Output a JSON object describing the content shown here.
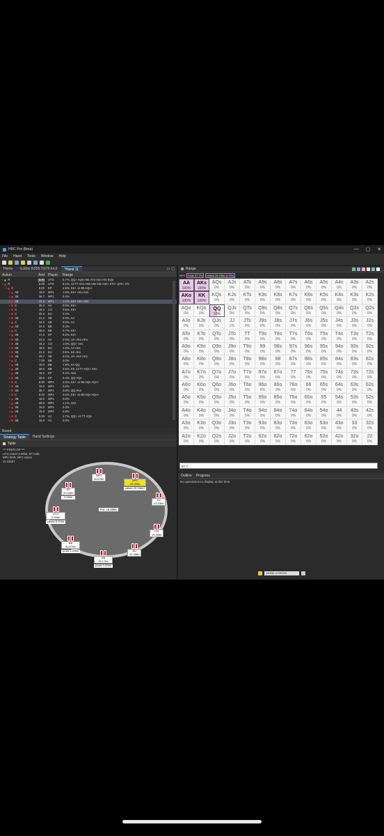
{
  "window": {
    "title": "HRC Pro (Beta)",
    "controls": [
      "—",
      "▢",
      "✕"
    ]
  },
  "menu": [
    "File",
    "Hand",
    "Tools",
    "Window",
    "Help"
  ],
  "doc_tabs": [
    "Home",
    "\\Lobby 6\\255.7(67h.hrc3",
    "*Hand 11"
  ],
  "tree": {
    "headers": [
      "Action",
      "Amt [BB]",
      "Player",
      "Range"
    ],
    "rows": [
      {
        "action": "R",
        "amt": "2.00",
        "player": "UTG",
        "range": "5.7%, QQ+ AQs-A5s A7o-A4o ATo KQo",
        "color": "#3cb44b"
      },
      {
        "action": "R",
        "amt": "8.00",
        "player": "UTG",
        "range": "8.1%, JJ-TT AKs-A9s A8s A5s A3s+ KTs+ QTs+ JTs",
        "color": "#e6194b"
      },
      {
        "action": "C",
        "amt": "8.00",
        "player": "EP",
        "range": "4.5%, KK+ JJ-99 AQo+",
        "color": "#e6194b"
      },
      {
        "action": "3B",
        "amt": "18.0",
        "player": "MP1",
        "range": "1.9%, KK+ AKo AKs",
        "color": "#e6194b"
      },
      {
        "action": "3B",
        "amt": "36.7",
        "player": "MP1",
        "range": "0.2%",
        "color": "#e6194b"
      },
      {
        "action": "3B",
        "amt": "25.3",
        "player": "MP1",
        "range": "1.1%, KK+ AKo AKs",
        "color": "#e6194b"
      },
      {
        "action": "C",
        "amt": "25.3",
        "player": "HJ",
        "range": "0.5%, KK+",
        "color": "#e6194b"
      },
      {
        "action": "C",
        "amt": "19.3",
        "player": "CO",
        "range": "0.5%, KK+",
        "color": "#e6194b"
      },
      {
        "action": "C",
        "amt": "25.3",
        "player": "BU",
        "range": "0.2%",
        "color": "#e6194b"
      },
      {
        "action": "3B",
        "amt": "31.3",
        "player": "SB",
        "range": "0.6%, AA",
        "color": "#e6194b"
      },
      {
        "action": "C",
        "amt": "34.0",
        "player": "SB",
        "range": "0.5%, AA",
        "color": "#e6194b"
      },
      {
        "action": "4B",
        "amt": "24.3",
        "player": "BB",
        "range": "0.2%",
        "color": "#e6194b"
      },
      {
        "action": "C",
        "amt": "28.0",
        "player": "BB",
        "range": "0.7%, KK+",
        "color": "#e6194b"
      },
      {
        "action": "3B",
        "amt": "17.3",
        "player": "EP",
        "range": "0.0%, KK+",
        "color": "#e6194b"
      },
      {
        "action": "3B",
        "amt": "23.3",
        "player": "HJ",
        "range": "2.0%, JJ+ AKs AKo",
        "color": "#e6194b"
      },
      {
        "action": "3B",
        "amt": "19.3",
        "player": "CO",
        "range": "1.0%, QQ+ AKs",
        "color": "#e6194b"
      },
      {
        "action": "3B",
        "amt": "18.0",
        "player": "BU",
        "range": "1.2%, AA AKs",
        "color": "#e6194b"
      },
      {
        "action": "3B",
        "amt": "31.3",
        "player": "BU",
        "range": "0.5%, KK AKs",
        "color": "#e6194b"
      },
      {
        "action": "3B",
        "amt": "29.7",
        "player": "SB",
        "range": "3.0%, JJ+ AKs AKo",
        "color": "#e6194b"
      },
      {
        "action": "C",
        "amt": "7.00",
        "player": "BB",
        "range": "0.0%",
        "color": "#e6194b"
      },
      {
        "action": "3B",
        "amt": "18.0",
        "player": "BB",
        "range": "1.9%, AA QQ",
        "color": "#e6194b"
      },
      {
        "action": "3B",
        "amt": "28.0",
        "player": "BB",
        "range": "2.6%, KK JJ-TT AQs+ AKo",
        "color": "#e6194b"
      },
      {
        "action": "3B",
        "amt": "15.0",
        "player": "EP",
        "range": "0.4%, AKs",
        "color": "#e6194b"
      },
      {
        "action": "3B",
        "amt": "28.0",
        "player": "EP",
        "range": "0.4%, QQ AQs",
        "color": "#e6194b"
      },
      {
        "action": "C",
        "amt": "8.00",
        "player": "MP1",
        "range": "4.5%, KK+ JJ-99 AQs AQo+",
        "color": "#e6194b"
      },
      {
        "action": "3B",
        "amt": "15.0",
        "player": "MP1",
        "range": "0.6%",
        "color": "#e6194b"
      },
      {
        "action": "3B",
        "amt": "36.7",
        "player": "MP1",
        "range": "0.8%, QQ AKs",
        "color": "#e6194b"
      },
      {
        "action": "C",
        "amt": "8.00",
        "player": "MP2",
        "range": "3.6%, KK+ JJ-99 AQs AQo+",
        "color": "#e6194b"
      },
      {
        "action": "3B",
        "amt": "15.0",
        "player": "MP1",
        "range": "0.0%",
        "color": "#e6194b"
      },
      {
        "action": "3B",
        "amt": "28.0",
        "player": "MP2",
        "range": "1.1%, AKs",
        "color": "#e6194b"
      },
      {
        "action": "3B",
        "amt": "15.0",
        "player": "MP2",
        "range": "0.3%",
        "color": "#e6194b"
      },
      {
        "action": "3B",
        "amt": "15.0",
        "player": "MP2",
        "range": "0.8%",
        "color": "#e6194b"
      },
      {
        "action": "C",
        "amt": "8.00",
        "player": "HJ",
        "range": "2.7%, QQ+ JJ-TT AQs",
        "color": "#e6194b"
      },
      {
        "action": "3B",
        "amt": "15.0",
        "player": "HJ",
        "range": "0.0%",
        "color": "#e6194b"
      }
    ]
  },
  "board_label": "Board:",
  "lower_tabs": [
    "Strategy Table",
    "Hand Settings"
  ],
  "table_tab": "Table",
  "hand_log": [
    "*** PREFLOP ***",
    "UTG raises 8.00bb, EP calls,",
    "MP1 folds, MP2 raises",
    "25.33bb7"
  ],
  "pot": "Pot:   18.50bb",
  "seats": [
    {
      "name": "MP1",
      "stack": "26.67bb",
      "note": "",
      "active": false
    },
    {
      "name": "MP2",
      "stack": "25.00bb",
      "note": "raises 25.33bb?",
      "active": true
    },
    {
      "name": "HJ",
      "stack": "23.33bb",
      "note": "",
      "active": false
    },
    {
      "name": "CO",
      "stack": "19.33bb",
      "note": "",
      "active": false
    },
    {
      "name": "BU",
      "stack": "31.33bb",
      "note": "",
      "active": false
    },
    {
      "name": "SB",
      "stack": "28.17bb",
      "note": "posts 0.50bb",
      "active": false
    },
    {
      "name": "BB",
      "stack": "84.67bb",
      "note": "posts 1.00bb",
      "active": false
    },
    {
      "name": "UTG",
      "stack": "0.00bb",
      "note": "raises 8.00bb",
      "active": false
    },
    {
      "name": "EP",
      "stack": "20.00bb",
      "note": "0.00bb",
      "active": false
    }
  ],
  "range_panel": {
    "title": "Range",
    "info": [
      "MP2",
      "folds 97.7%",
      "raises 25.33bb (2.3%)"
    ],
    "icon_colors": [
      "#7fbf7f",
      "#a0a0ff",
      "#ffb0b0",
      "#f0f0f0",
      "#7fbfbf",
      "#ffffff"
    ]
  },
  "range_grid": [
    [
      {
        "h": "AA",
        "p": "100%",
        "s": "pink"
      },
      {
        "h": "AKs",
        "p": "100%",
        "s": "pink"
      },
      {
        "h": "AQs",
        "p": "0%"
      },
      {
        "h": "AJs",
        "p": "0%"
      },
      {
        "h": "ATs",
        "p": "0%"
      },
      {
        "h": "A9s",
        "p": "0%"
      },
      {
        "h": "A8s",
        "p": "0%"
      },
      {
        "h": "A7s",
        "p": "0%"
      },
      {
        "h": "A6s",
        "p": "0%"
      },
      {
        "h": "A5s",
        "p": "0%"
      },
      {
        "h": "A4s",
        "p": "0%"
      },
      {
        "h": "A3s",
        "p": "0%"
      },
      {
        "h": "A2s",
        "p": "0%"
      }
    ],
    [
      {
        "h": "AKo",
        "p": "100%",
        "s": "pink"
      },
      {
        "h": "KK",
        "p": "100%",
        "s": "pink"
      },
      {
        "h": "KQs",
        "p": "0%"
      },
      {
        "h": "KJs",
        "p": "0%"
      },
      {
        "h": "KTs",
        "p": "0%"
      },
      {
        "h": "K9s",
        "p": "0%"
      },
      {
        "h": "K8s",
        "p": "0%"
      },
      {
        "h": "K7s",
        "p": "0%"
      },
      {
        "h": "K6s",
        "p": "0%"
      },
      {
        "h": "K5s",
        "p": "0%"
      },
      {
        "h": "K4s",
        "p": "0%"
      },
      {
        "h": "K3s",
        "p": "0%"
      },
      {
        "h": "K2s",
        "p": "0%"
      }
    ],
    [
      {
        "h": "AQo",
        "p": "0%"
      },
      {
        "h": "KQo",
        "p": "0%"
      },
      {
        "h": "QQ",
        "p": "50%",
        "s": "half"
      },
      {
        "h": "QJs",
        "p": "0%"
      },
      {
        "h": "QTs",
        "p": "0%"
      },
      {
        "h": "Q9s",
        "p": "0%"
      },
      {
        "h": "Q8s",
        "p": "0%"
      },
      {
        "h": "Q7s",
        "p": "0%"
      },
      {
        "h": "Q6s",
        "p": "0%"
      },
      {
        "h": "Q5s",
        "p": "0%"
      },
      {
        "h": "Q4s",
        "p": "0%"
      },
      {
        "h": "Q3s",
        "p": "0%"
      },
      {
        "h": "Q2s",
        "p": "0%"
      }
    ],
    [
      {
        "h": "AJo",
        "p": "0%"
      },
      {
        "h": "KJo",
        "p": "0%"
      },
      {
        "h": "QJo",
        "p": "0%"
      },
      {
        "h": "JJ",
        "p": "1%"
      },
      {
        "h": "JTs",
        "p": "0%"
      },
      {
        "h": "J9s",
        "p": "0%"
      },
      {
        "h": "J8s",
        "p": "0%"
      },
      {
        "h": "J7s",
        "p": "0%"
      },
      {
        "h": "J6s",
        "p": "0%"
      },
      {
        "h": "J5s",
        "p": "0%"
      },
      {
        "h": "J4s",
        "p": "0%"
      },
      {
        "h": "J3s",
        "p": "0%"
      },
      {
        "h": "J2s",
        "p": "0%"
      }
    ],
    [
      {
        "h": "ATo",
        "p": "0%"
      },
      {
        "h": "KTo",
        "p": "0%"
      },
      {
        "h": "QTo",
        "p": "0%"
      },
      {
        "h": "JTo",
        "p": "0%"
      },
      {
        "h": "TT",
        "p": "0%"
      },
      {
        "h": "T9s",
        "p": "0%"
      },
      {
        "h": "T8s",
        "p": "0%"
      },
      {
        "h": "T7s",
        "p": "0%"
      },
      {
        "h": "T6s",
        "p": "0%"
      },
      {
        "h": "T5s",
        "p": "0%"
      },
      {
        "h": "T4s",
        "p": "0%"
      },
      {
        "h": "T3s",
        "p": "0%"
      },
      {
        "h": "T2s",
        "p": "0%"
      }
    ],
    [
      {
        "h": "A9o",
        "p": "0%"
      },
      {
        "h": "K9o",
        "p": "0%"
      },
      {
        "h": "Q9o",
        "p": "0%"
      },
      {
        "h": "J9o",
        "p": "0%"
      },
      {
        "h": "T9o",
        "p": "0%"
      },
      {
        "h": "99",
        "p": "0%"
      },
      {
        "h": "98s",
        "p": "0%"
      },
      {
        "h": "97s",
        "p": "0%"
      },
      {
        "h": "96s",
        "p": "0%"
      },
      {
        "h": "95s",
        "p": "0%"
      },
      {
        "h": "94s",
        "p": "0%"
      },
      {
        "h": "93s",
        "p": "0%"
      },
      {
        "h": "92s",
        "p": "0%"
      }
    ],
    [
      {
        "h": "A8o",
        "p": "0%"
      },
      {
        "h": "K8o",
        "p": "0%"
      },
      {
        "h": "Q8o",
        "p": "0%"
      },
      {
        "h": "J8o",
        "p": "0%"
      },
      {
        "h": "T8o",
        "p": "0%"
      },
      {
        "h": "98o",
        "p": "0%"
      },
      {
        "h": "88",
        "p": "0%"
      },
      {
        "h": "87s",
        "p": "0%"
      },
      {
        "h": "86s",
        "p": "0%"
      },
      {
        "h": "85s",
        "p": "0%"
      },
      {
        "h": "84s",
        "p": "0%"
      },
      {
        "h": "83s",
        "p": "0%"
      },
      {
        "h": "82s",
        "p": "0%"
      }
    ],
    [
      {
        "h": "A7o",
        "p": "0%"
      },
      {
        "h": "K7o",
        "p": "0%"
      },
      {
        "h": "Q7o",
        "p": "0%"
      },
      {
        "h": "J7o",
        "p": "0%"
      },
      {
        "h": "T7o",
        "p": "0%"
      },
      {
        "h": "97o",
        "p": "0%"
      },
      {
        "h": "87o",
        "p": "0%"
      },
      {
        "h": "77",
        "p": "0%"
      },
      {
        "h": "76s",
        "p": "0%"
      },
      {
        "h": "75s",
        "p": "0%"
      },
      {
        "h": "74s",
        "p": "0%"
      },
      {
        "h": "73s",
        "p": "0%"
      },
      {
        "h": "72s",
        "p": "0%"
      }
    ],
    [
      {
        "h": "A6o",
        "p": "0%"
      },
      {
        "h": "K6o",
        "p": "0%"
      },
      {
        "h": "Q6o",
        "p": "0%"
      },
      {
        "h": "J6o",
        "p": "0%"
      },
      {
        "h": "T6o",
        "p": "0%"
      },
      {
        "h": "96o",
        "p": "0%"
      },
      {
        "h": "86o",
        "p": "0%"
      },
      {
        "h": "76o",
        "p": "0%"
      },
      {
        "h": "66",
        "p": "0%"
      },
      {
        "h": "65s",
        "p": "0%"
      },
      {
        "h": "64s",
        "p": "0%"
      },
      {
        "h": "63s",
        "p": "0%"
      },
      {
        "h": "62s",
        "p": "0%"
      }
    ],
    [
      {
        "h": "A5o",
        "p": "0%"
      },
      {
        "h": "K5o",
        "p": "0%"
      },
      {
        "h": "Q5o",
        "p": "0%"
      },
      {
        "h": "J5o",
        "p": "0%"
      },
      {
        "h": "T5o",
        "p": "0%"
      },
      {
        "h": "95o",
        "p": "0%"
      },
      {
        "h": "85o",
        "p": "0%"
      },
      {
        "h": "75o",
        "p": "0%"
      },
      {
        "h": "65o",
        "p": "0%"
      },
      {
        "h": "55",
        "p": "0%"
      },
      {
        "h": "54s",
        "p": "0%"
      },
      {
        "h": "53s",
        "p": "0%"
      },
      {
        "h": "52s",
        "p": "0%"
      }
    ],
    [
      {
        "h": "A4o",
        "p": "0%"
      },
      {
        "h": "K4o",
        "p": "0%"
      },
      {
        "h": "Q4o",
        "p": "0%"
      },
      {
        "h": "J4o",
        "p": "0%"
      },
      {
        "h": "T4o",
        "p": "0%"
      },
      {
        "h": "94o",
        "p": "0%"
      },
      {
        "h": "84o",
        "p": "0%"
      },
      {
        "h": "74o",
        "p": "0%"
      },
      {
        "h": "64o",
        "p": "0%"
      },
      {
        "h": "54o",
        "p": "0%"
      },
      {
        "h": "44",
        "p": "0%"
      },
      {
        "h": "43s",
        "p": "0%"
      },
      {
        "h": "42s",
        "p": "0%"
      }
    ],
    [
      {
        "h": "A3o",
        "p": "0%"
      },
      {
        "h": "K3o",
        "p": "0%"
      },
      {
        "h": "Q3o",
        "p": "0%"
      },
      {
        "h": "J3o",
        "p": "0%"
      },
      {
        "h": "T3o",
        "p": "0%"
      },
      {
        "h": "93o",
        "p": "0%"
      },
      {
        "h": "83o",
        "p": "0%"
      },
      {
        "h": "73o",
        "p": "0%"
      },
      {
        "h": "63o",
        "p": "0%"
      },
      {
        "h": "53o",
        "p": "0%"
      },
      {
        "h": "43o",
        "p": "0%"
      },
      {
        "h": "33",
        "p": "0%"
      },
      {
        "h": "32s",
        "p": "0%"
      }
    ],
    [
      {
        "h": "A2o",
        "p": "0%"
      },
      {
        "h": "K2o",
        "p": "0%"
      },
      {
        "h": "Q2o",
        "p": "0%"
      },
      {
        "h": "J2o",
        "p": "0%"
      },
      {
        "h": "T2o",
        "p": "0%"
      },
      {
        "h": "92o",
        "p": "0%"
      },
      {
        "h": "82o",
        "p": "0%"
      },
      {
        "h": "72o",
        "p": "0%"
      },
      {
        "h": "62o",
        "p": "0%"
      },
      {
        "h": "52o",
        "p": "0%"
      },
      {
        "h": "42o",
        "p": "0%"
      },
      {
        "h": "32o",
        "p": "0%"
      },
      {
        "h": "22",
        "p": "0%"
      }
    ]
  ],
  "range_input": "97.7",
  "outline_tabs": [
    "Outline",
    "Progress"
  ],
  "no_operations": "No operations to display at this time.",
  "heap": "1456M of 2832M"
}
